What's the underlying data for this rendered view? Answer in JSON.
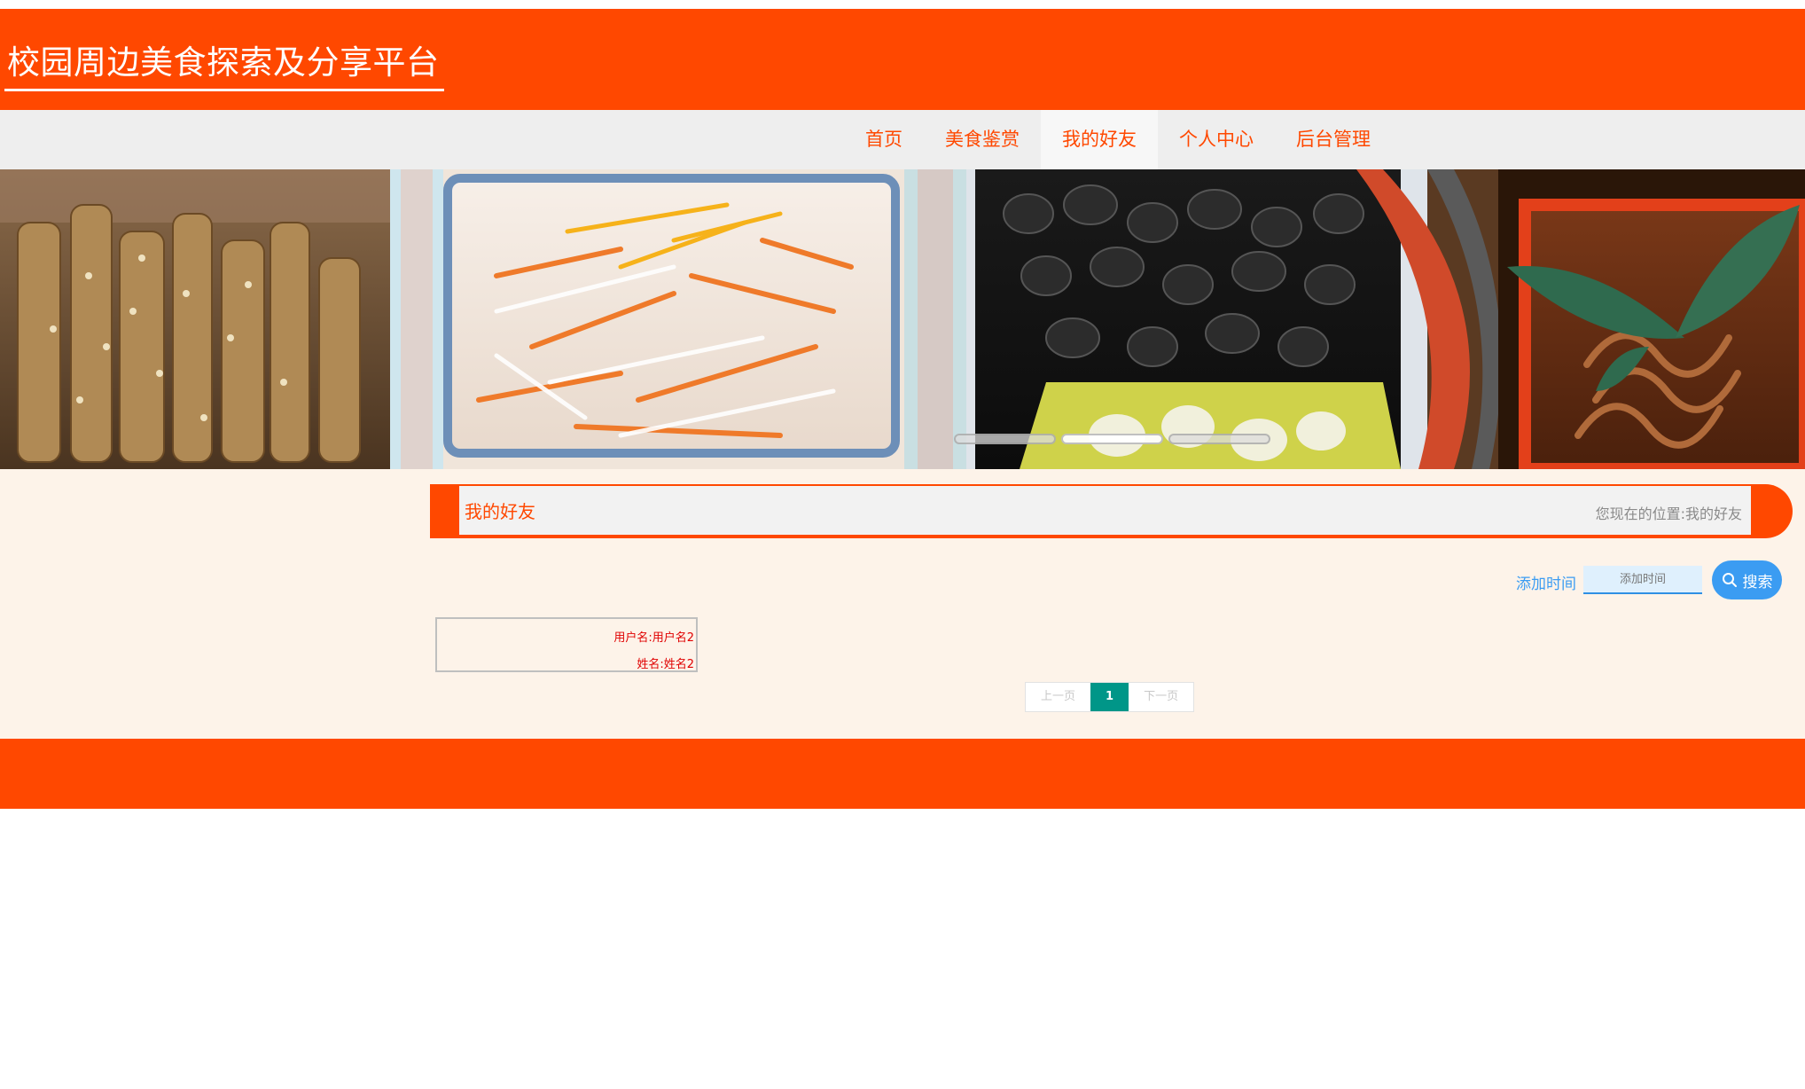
{
  "header": {
    "site_title": "校园周边美食探索及分享平台"
  },
  "nav": {
    "items": [
      {
        "label": "首页"
      },
      {
        "label": "美食鉴赏"
      },
      {
        "label": "我的好友",
        "active": true
      },
      {
        "label": "个人中心"
      },
      {
        "label": "后台管理"
      }
    ]
  },
  "banner": {
    "slide_count": 3,
    "active_slide": 1
  },
  "breadcrumb": {
    "title": "我的好友",
    "location_label": "您现在的位置:",
    "location_value": "我的好友"
  },
  "search": {
    "label": "添加时间",
    "placeholder": "添加时间",
    "button_label": "搜索"
  },
  "friends": [
    {
      "username_label": "用户名:",
      "username": "用户名2",
      "name_label": "姓名:",
      "name": "姓名2"
    }
  ],
  "pagination": {
    "prev": "上一页",
    "current": "1",
    "next": "下一页"
  },
  "colors": {
    "brand": "#ff4800",
    "content_bg": "#fdf3e9",
    "search_accent": "#3b9cf2",
    "pager_active": "#009688"
  }
}
